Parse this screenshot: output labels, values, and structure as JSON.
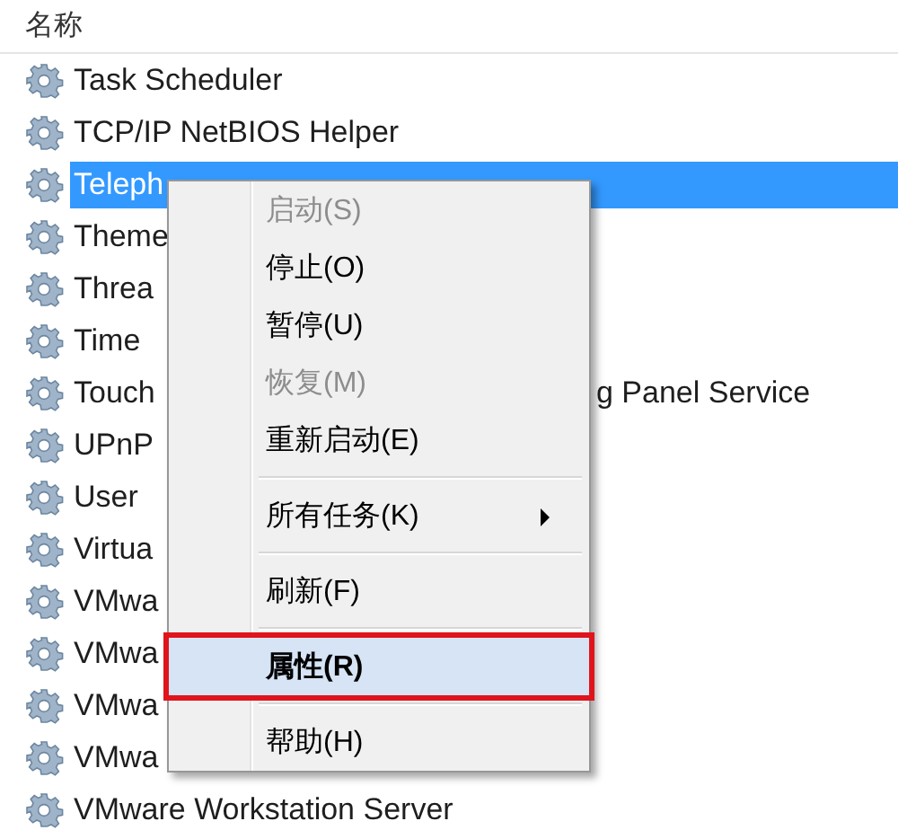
{
  "header": {
    "name_column": "名称"
  },
  "services": [
    {
      "name": "Task Scheduler",
      "selected": false
    },
    {
      "name": "TCP/IP NetBIOS Helper",
      "selected": false
    },
    {
      "name": "Teleph",
      "selected": true
    },
    {
      "name": "Theme",
      "selected": false
    },
    {
      "name": "Threa",
      "selected": false
    },
    {
      "name": "Time",
      "selected": false
    },
    {
      "name": "Touch",
      "tail": "g Panel Service",
      "selected": false
    },
    {
      "name": "UPnP",
      "selected": false
    },
    {
      "name": "User",
      "selected": false
    },
    {
      "name": "Virtua",
      "selected": false
    },
    {
      "name": "VMwa",
      "selected": false
    },
    {
      "name": "VMwa",
      "selected": false
    },
    {
      "name": "VMwa",
      "selected": false
    },
    {
      "name": "VMwa",
      "selected": false
    },
    {
      "name": "VMware Workstation Server",
      "selected": false
    }
  ],
  "context_menu": {
    "items": [
      {
        "kind": "item",
        "label": "启动(S)",
        "disabled": true,
        "highlighted": false
      },
      {
        "kind": "item",
        "label": "停止(O)",
        "disabled": false,
        "highlighted": false
      },
      {
        "kind": "item",
        "label": "暂停(U)",
        "disabled": false,
        "highlighted": false
      },
      {
        "kind": "item",
        "label": "恢复(M)",
        "disabled": true,
        "highlighted": false
      },
      {
        "kind": "item",
        "label": "重新启动(E)",
        "disabled": false,
        "highlighted": false
      },
      {
        "kind": "separator"
      },
      {
        "kind": "submenu",
        "label": "所有任务(K)",
        "disabled": false,
        "highlighted": false
      },
      {
        "kind": "separator"
      },
      {
        "kind": "item",
        "label": "刷新(F)",
        "disabled": false,
        "highlighted": false
      },
      {
        "kind": "separator"
      },
      {
        "kind": "item",
        "label": "属性(R)",
        "disabled": false,
        "highlighted": true,
        "default": true
      },
      {
        "kind": "separator"
      },
      {
        "kind": "item",
        "label": "帮助(H)",
        "disabled": false,
        "highlighted": false
      }
    ]
  }
}
